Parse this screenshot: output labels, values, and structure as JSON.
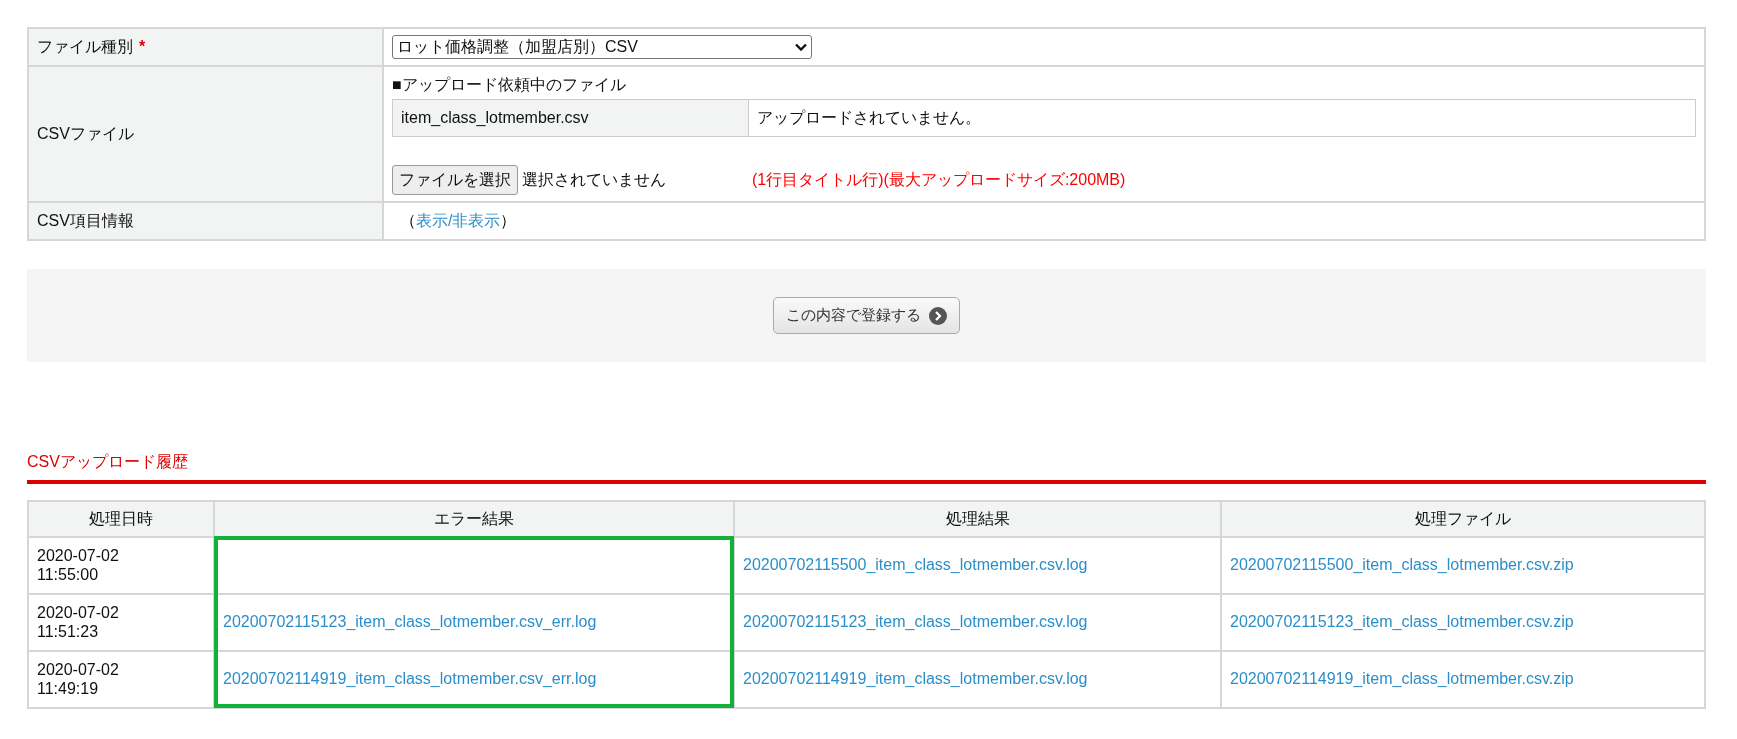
{
  "form": {
    "rows": [
      {
        "kind": "select",
        "label": "ファイル種別",
        "required_mark": "*",
        "value": "ロット価格調整（加盟店別）CSV"
      },
      {
        "kind": "file",
        "label": "CSVファイル",
        "pending_heading": "■アップロード依頼中のファイル",
        "pending_file": {
          "name": "item_class_lotmember.csv",
          "status": "アップロードされていません。"
        },
        "choose_button": "ファイルを選択",
        "chosen": "選択されていません",
        "note": "(1行目タイトル行)(最大アップロードサイズ:200MB)"
      },
      {
        "kind": "toggle",
        "label": "CSV項目情報",
        "open_paren": "（",
        "link": "表示/非表示",
        "close_paren": "）"
      }
    ]
  },
  "submit_button": "この内容で登録する",
  "history": {
    "title": "CSVアップロード履歴",
    "columns": [
      {
        "label": "処理日時",
        "highlighted": false
      },
      {
        "label": "エラー結果",
        "highlighted": true
      },
      {
        "label": "処理結果",
        "highlighted": false
      },
      {
        "label": "処理ファイル",
        "highlighted": false
      }
    ],
    "rows": [
      {
        "date": "2020-07-02",
        "time": "11:55:00",
        "error_log": "",
        "result_log": "20200702115500_item_class_lotmember.csv.log",
        "file": "20200702115500_item_class_lotmember.csv.zip"
      },
      {
        "date": "2020-07-02",
        "time": "11:51:23",
        "error_log": "20200702115123_item_class_lotmember.csv_err.log",
        "result_log": "20200702115123_item_class_lotmember.csv.log",
        "file": "20200702115123_item_class_lotmember.csv.zip"
      },
      {
        "date": "2020-07-02",
        "time": "11:49:19",
        "error_log": "20200702114919_item_class_lotmember.csv_err.log",
        "result_log": "20200702114919_item_class_lotmember.csv.log",
        "file": "20200702114919_item_class_lotmember.csv.zip"
      }
    ]
  }
}
